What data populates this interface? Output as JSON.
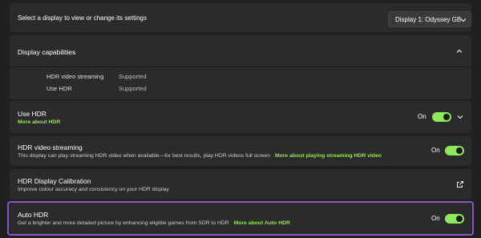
{
  "header": {
    "prompt": "Select a display to view or change its settings",
    "display_select": "Display 1: Odyssey GB"
  },
  "capabilities": {
    "title": "Display capabilities",
    "rows": [
      {
        "label": "HDR video streaming",
        "value": "Supported"
      },
      {
        "label": "Use HDR",
        "value": "Supported"
      }
    ]
  },
  "use_hdr": {
    "title": "Use HDR",
    "link": "More about HDR",
    "state": "On"
  },
  "hdr_streaming": {
    "title": "HDR video streaming",
    "desc": "This display can play streaming HDR video when available—for best results, play HDR videos full screen",
    "link": "More about playing streaming HDR video",
    "state": "On"
  },
  "calibration": {
    "title": "HDR Display Calibration",
    "desc": "Improve colour accuracy and consistency on your HDR display"
  },
  "auto_hdr": {
    "title": "Auto HDR",
    "desc": "Get a brighter and more detailed picture by enhancing eligible games from SDR to HDR",
    "link": "More about Auto HDR",
    "state": "On"
  },
  "colors": {
    "accent": "#8ee85b",
    "highlight": "#8b57c9",
    "card": "#2b2b2b",
    "background": "#202020"
  }
}
